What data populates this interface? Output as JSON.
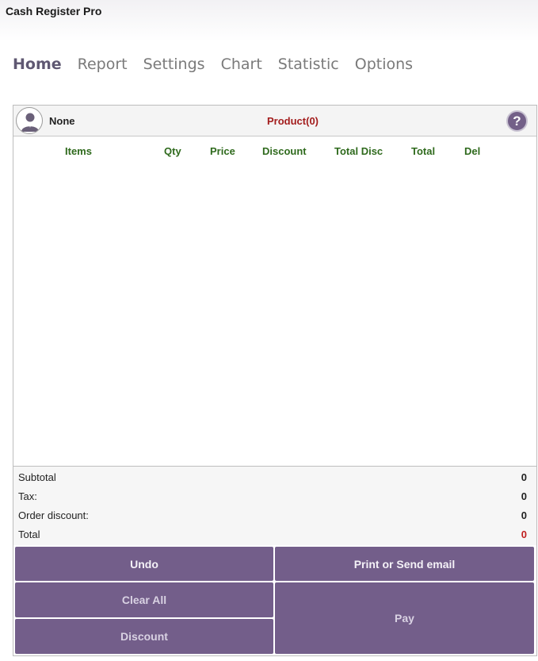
{
  "app": {
    "title": "Cash Register Pro"
  },
  "nav": {
    "tabs": [
      {
        "label": "Home"
      },
      {
        "label": "Report"
      },
      {
        "label": "Settings"
      },
      {
        "label": "Chart"
      },
      {
        "label": "Statistic"
      },
      {
        "label": "Options"
      }
    ],
    "active": "Home"
  },
  "customer": {
    "name": "None",
    "avatar_icon": "user-icon",
    "product_count_label": "Product(0)",
    "help_glyph": "?"
  },
  "table": {
    "columns": [
      "Items",
      "Qty",
      "Price",
      "Discount",
      "Total Disc",
      "Total",
      "Del"
    ],
    "rows": []
  },
  "summary": {
    "subtotal_label": "Subtotal",
    "subtotal_value": "0",
    "tax_label": "Tax:",
    "tax_value": "0",
    "order_discount_label": "Order discount:",
    "order_discount_value": "0",
    "total_label": "Total",
    "total_value": "0"
  },
  "actions": {
    "undo": "Undo",
    "print_email": "Print or Send email",
    "clear_all": "Clear All",
    "pay": "Pay",
    "discount": "Discount"
  },
  "colors": {
    "accent": "#735e8a",
    "header_green": "#2f6a1d",
    "alert_red": "#a31d1d"
  }
}
